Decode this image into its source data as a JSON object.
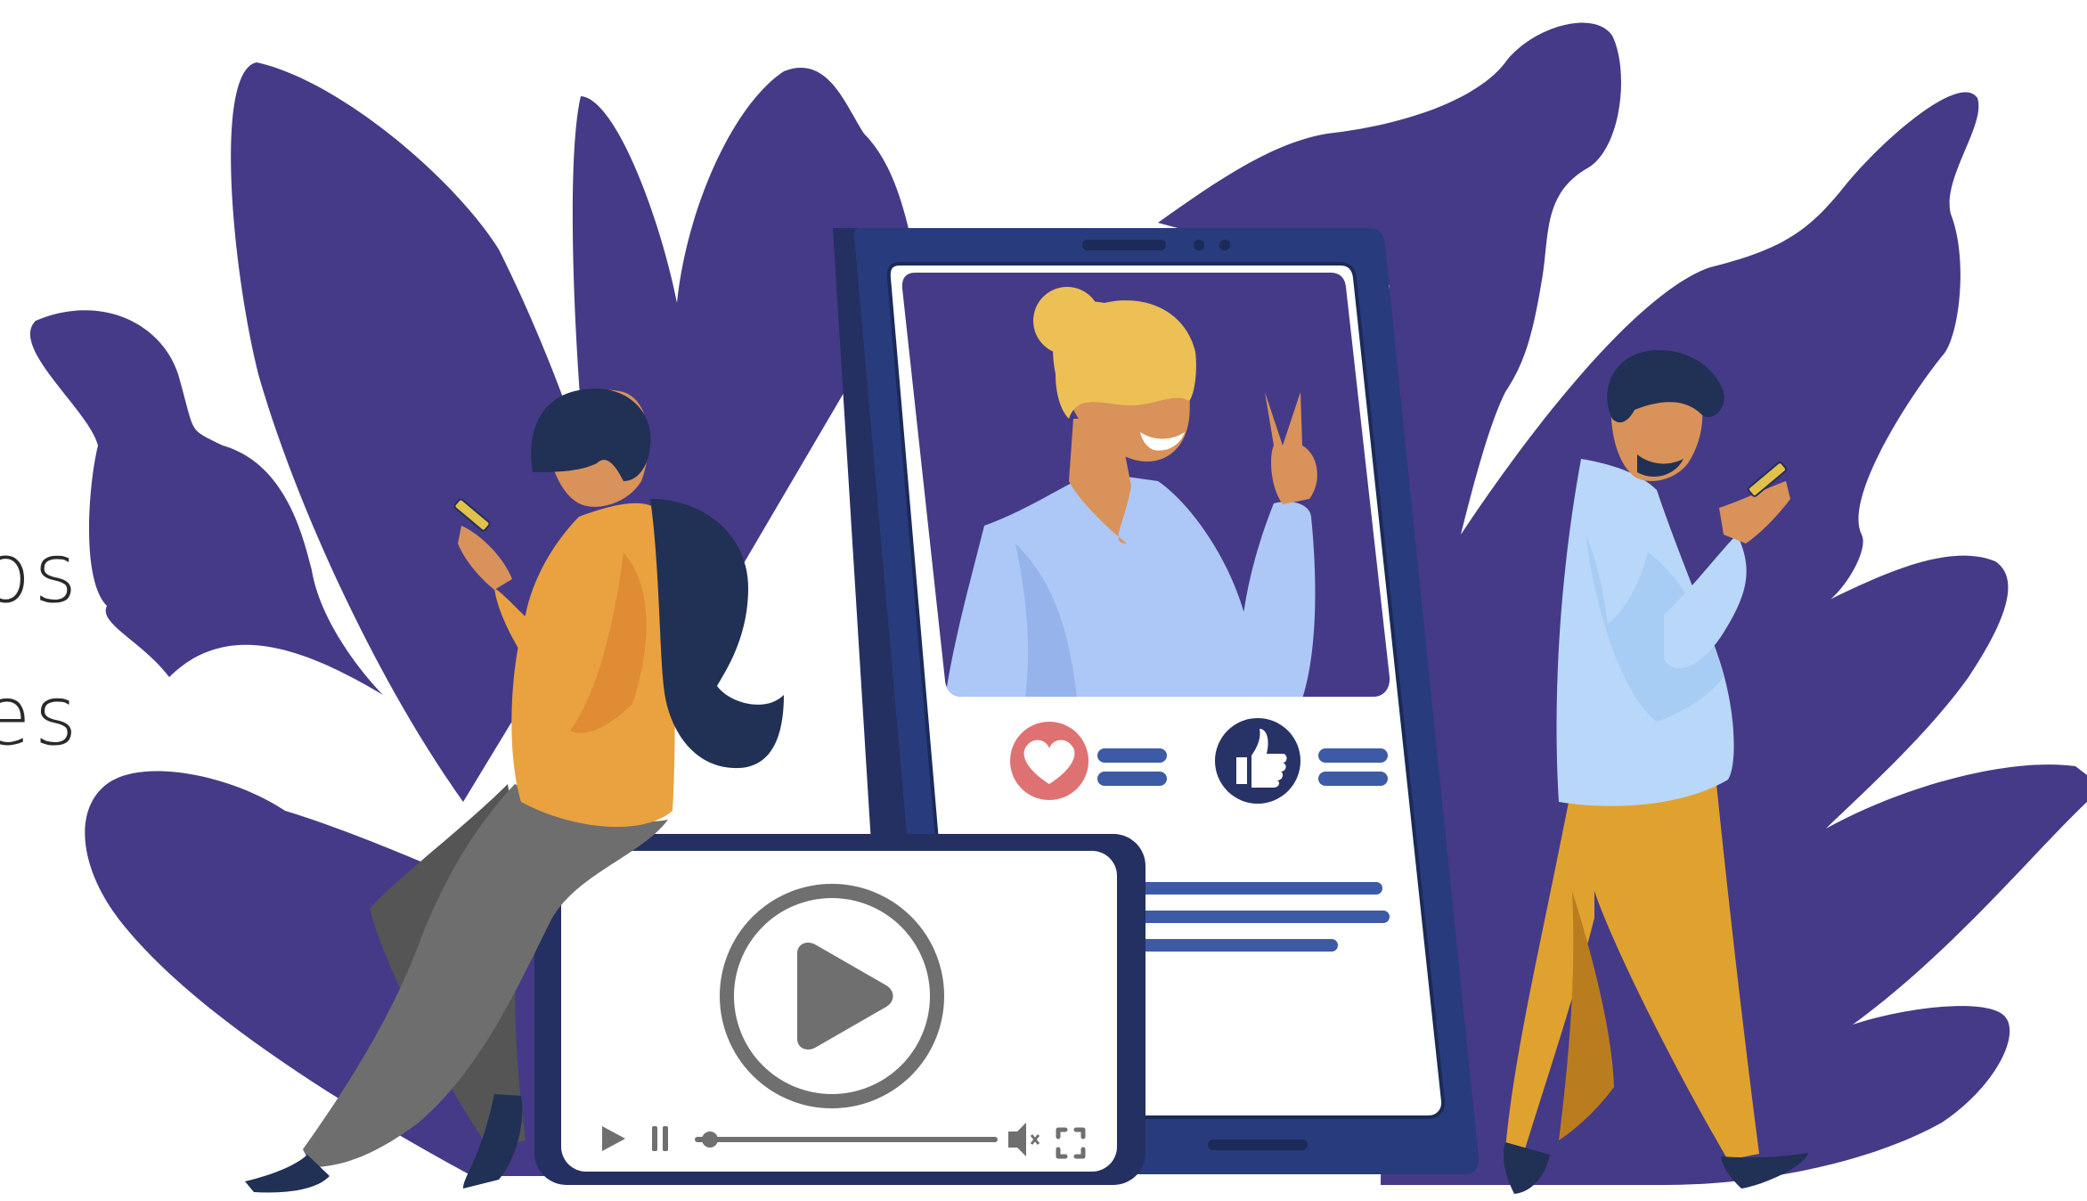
{
  "visible_text": {
    "line_1": "os",
    "line_2": "es"
  },
  "icons": {
    "heart": "heart-icon",
    "like": "thumbs-up-icon",
    "play": "play-icon",
    "pause": "pause-icon",
    "mute": "speaker-mute-icon",
    "fullscreen": "fullscreen-icon"
  },
  "video_player": {
    "progress": 0.05
  },
  "colors": {
    "background": "#ffffff",
    "leaves": "#453a87",
    "phone_frame": "#283b7c",
    "phone_dark": "#243061",
    "screen_bg": "#453a87",
    "hair_yellow": "#ecc055",
    "skin": "#d8925a",
    "shirt_light_blue": "#adc8f6",
    "heart_red": "#de7272",
    "like_navy": "#273266",
    "text_lines": "#3d5aa6",
    "player_frame": "#243061",
    "player_gray": "#6f6f6f",
    "orange_sweater": "#e9a23f",
    "gray_pants": "#6e6e6e",
    "mustard_pants": "#e0a22e",
    "navy_hair": "#213055"
  }
}
